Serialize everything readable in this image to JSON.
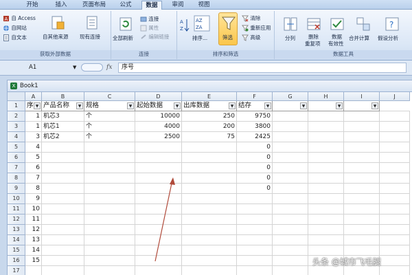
{
  "tabs": [
    {
      "label": "开始",
      "active": false
    },
    {
      "label": "插入",
      "active": false
    },
    {
      "label": "页面布局",
      "active": false
    },
    {
      "label": "公式",
      "active": false
    },
    {
      "label": "数据",
      "active": true
    },
    {
      "label": "审阅",
      "active": false
    },
    {
      "label": "视图",
      "active": false
    }
  ],
  "ribbon": {
    "external": {
      "access": "自 Access",
      "website": "自网站",
      "text": "自文本",
      "other_sources": "自其他来源",
      "existing": "现有连接",
      "caption": "获取外部数据"
    },
    "connections": {
      "refresh_all": "全部刷新",
      "connections": "连接",
      "properties": "属性",
      "edit_links": "编辑链接",
      "caption": "连接"
    },
    "sort_filter": {
      "sort": "排序...",
      "filter": "筛选",
      "clear": "清除",
      "reapply": "重新应用",
      "advanced": "高级",
      "caption": "排序和筛选"
    },
    "data_tools": {
      "split": "分列",
      "remove_dup_1": "删除",
      "remove_dup_2": "重复项",
      "validation_1": "数据",
      "validation_2": "有效性",
      "consolidate": "合并计算",
      "whatif": "假设分析",
      "caption": "数据工具"
    }
  },
  "formula_bar": {
    "name_box": "A1",
    "fx": "fx",
    "content": "序号"
  },
  "workbook": {
    "title": "Book1",
    "columns": [
      "A",
      "B",
      "C",
      "D",
      "E",
      "F",
      "G",
      "H",
      "I",
      "J"
    ],
    "row_numbers": [
      "1",
      "2",
      "3",
      "4",
      "5",
      "6",
      "7",
      "8",
      "9",
      "10",
      "11",
      "12",
      "13",
      "14",
      "15",
      "16",
      "17"
    ],
    "headers": [
      "序",
      "产品名称",
      "规格",
      "起始数据",
      "出库数据",
      "结存",
      "",
      "",
      ""
    ],
    "rows": [
      [
        "1",
        "机芯3",
        "个",
        "10000",
        "250",
        "9750"
      ],
      [
        "1",
        "机芯1",
        "个",
        "4000",
        "200",
        "3800"
      ],
      [
        "3",
        "机芯2",
        "个",
        "2500",
        "75",
        "2425"
      ],
      [
        "4",
        "",
        "",
        "",
        "",
        "0"
      ],
      [
        "5",
        "",
        "",
        "",
        "",
        "0"
      ],
      [
        "6",
        "",
        "",
        "",
        "",
        "0"
      ],
      [
        "7",
        "",
        "",
        "",
        "",
        "0"
      ],
      [
        "8",
        "",
        "",
        "",
        "",
        "0"
      ],
      [
        "9",
        "",
        "",
        "",
        "",
        ""
      ],
      [
        "10",
        "",
        "",
        "",
        "",
        ""
      ],
      [
        "11",
        "",
        "",
        "",
        "",
        ""
      ],
      [
        "12",
        "",
        "",
        "",
        "",
        ""
      ],
      [
        "13",
        "",
        "",
        "",
        "",
        ""
      ],
      [
        "14",
        "",
        "",
        "",
        "",
        ""
      ],
      [
        "15",
        "",
        "",
        "",
        "",
        ""
      ]
    ]
  },
  "watermark": "头条 @城市飞毛腿",
  "colors": {
    "ribbon_bg": "#dbe7f6",
    "accent": "#fbc64b",
    "arrow": "#b04a3a"
  }
}
